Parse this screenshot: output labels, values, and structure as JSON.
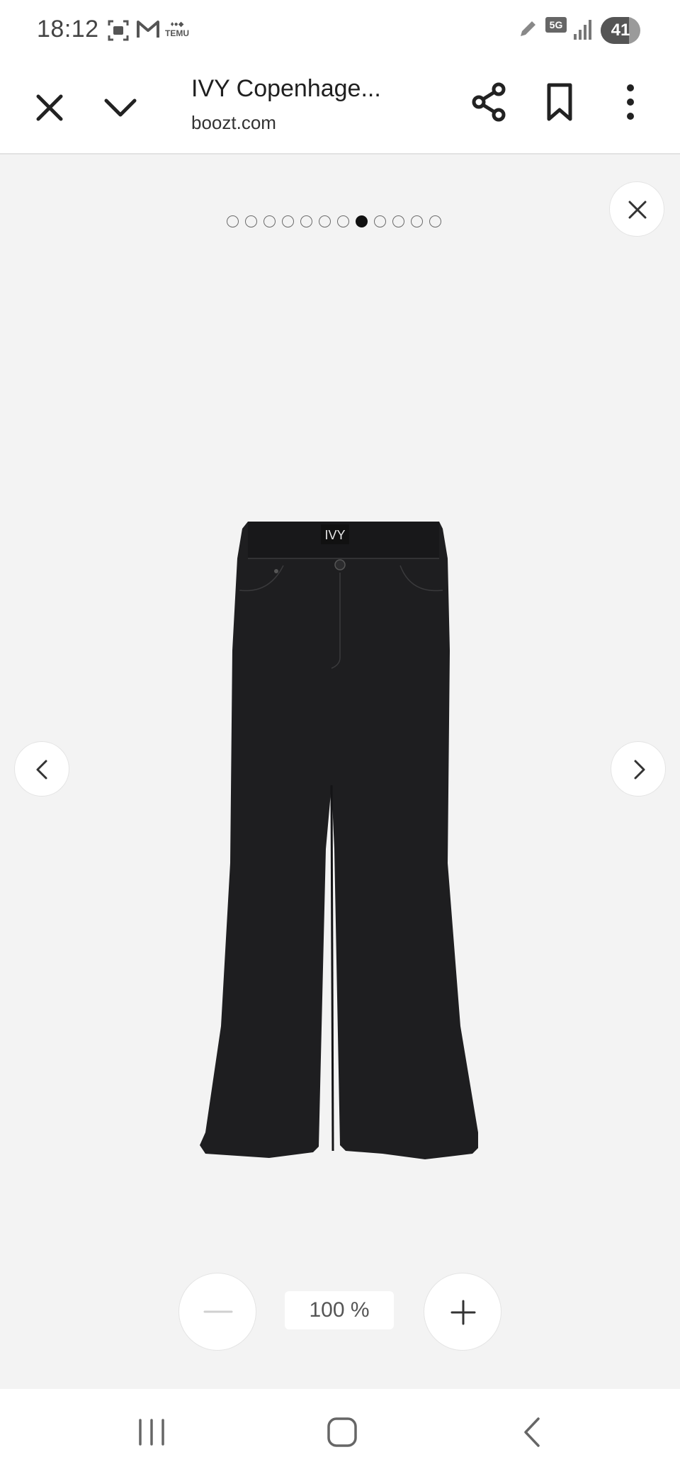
{
  "status_bar": {
    "time": "18:12",
    "temu_label": "TEMU",
    "network": "5G",
    "battery": "41",
    "icons": [
      "screenshot-icon",
      "gmail-icon",
      "temu-icon",
      "pen-icon",
      "signal-icon"
    ]
  },
  "toolbar": {
    "title": "IVY Copenhage...",
    "url": "boozt.com",
    "icons": [
      "close-icon",
      "chevron-down-icon",
      "share-icon",
      "bookmark-icon",
      "more-vert-icon"
    ]
  },
  "viewer": {
    "image_count": 12,
    "active_index": 7,
    "brand_label": "IVY",
    "zoom_level": "100 %",
    "icons": [
      "close-icon",
      "chevron-left-icon",
      "chevron-right-icon",
      "minus-icon",
      "plus-icon"
    ]
  },
  "nav_bar": {
    "icons": [
      "recent-apps-icon",
      "home-icon",
      "back-icon"
    ]
  },
  "colors": {
    "viewer_background": "#f3f3f3",
    "product": "#1e1e20",
    "active_dot": "#111111"
  }
}
